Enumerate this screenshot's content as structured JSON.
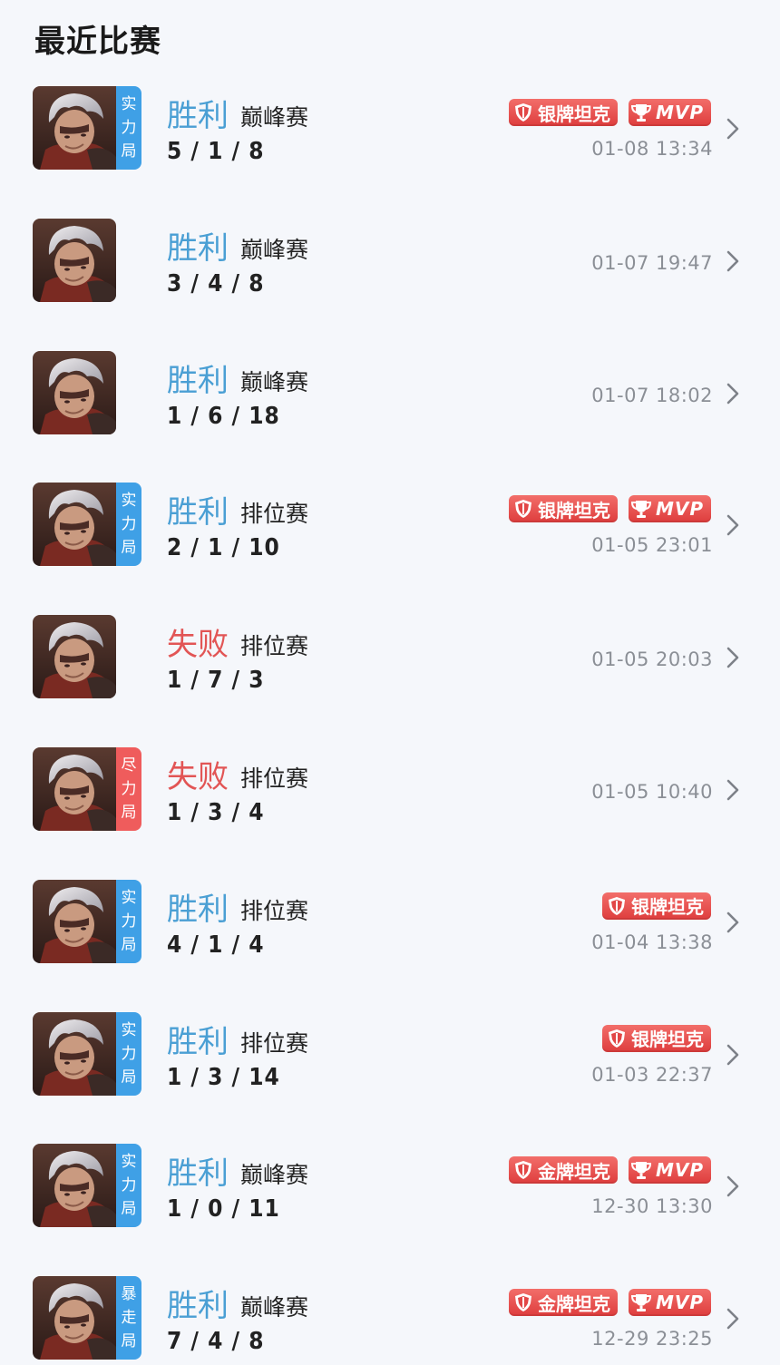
{
  "page": {
    "title": "最近比赛"
  },
  "colors": {
    "win": "#4a9fd4",
    "loss": "#e25555",
    "tag_blue": "#3fa0e6",
    "tag_red": "#ef5c5c",
    "badge_red": "#e24646"
  },
  "icons": {
    "tank_badge": "shield-icon",
    "mvp_badge": "trophy-icon",
    "chevron": "chevron-right-icon"
  },
  "matches": [
    {
      "result": "胜利",
      "outcome": "win",
      "mode": "巅峰赛",
      "kda": "5 / 1 / 8",
      "time": "01-08  13:34",
      "tag": [
        "实",
        "力",
        "局"
      ],
      "tag_color": "blue",
      "badges": [
        "银牌坦克",
        "MVP"
      ]
    },
    {
      "result": "胜利",
      "outcome": "win",
      "mode": "巅峰赛",
      "kda": "3 / 4 / 8",
      "time": "01-07  19:47",
      "tag": null,
      "badges": []
    },
    {
      "result": "胜利",
      "outcome": "win",
      "mode": "巅峰赛",
      "kda": "1 / 6 / 18",
      "time": "01-07  18:02",
      "tag": null,
      "badges": []
    },
    {
      "result": "胜利",
      "outcome": "win",
      "mode": "排位赛",
      "kda": "2 / 1 / 10",
      "time": "01-05  23:01",
      "tag": [
        "实",
        "力",
        "局"
      ],
      "tag_color": "blue",
      "badges": [
        "银牌坦克",
        "MVP"
      ]
    },
    {
      "result": "失败",
      "outcome": "loss",
      "mode": "排位赛",
      "kda": "1 / 7 / 3",
      "time": "01-05  20:03",
      "tag": null,
      "badges": []
    },
    {
      "result": "失败",
      "outcome": "loss",
      "mode": "排位赛",
      "kda": "1 / 3 / 4",
      "time": "01-05  10:40",
      "tag": [
        "尽",
        "力",
        "局"
      ],
      "tag_color": "red",
      "badges": []
    },
    {
      "result": "胜利",
      "outcome": "win",
      "mode": "排位赛",
      "kda": "4 / 1 / 4",
      "time": "01-04  13:38",
      "tag": [
        "实",
        "力",
        "局"
      ],
      "tag_color": "blue",
      "badges": [
        "银牌坦克"
      ]
    },
    {
      "result": "胜利",
      "outcome": "win",
      "mode": "排位赛",
      "kda": "1 / 3 / 14",
      "time": "01-03  22:37",
      "tag": [
        "实",
        "力",
        "局"
      ],
      "tag_color": "blue",
      "badges": [
        "银牌坦克"
      ]
    },
    {
      "result": "胜利",
      "outcome": "win",
      "mode": "巅峰赛",
      "kda": "1 / 0 / 11",
      "time": "12-30  13:30",
      "tag": [
        "实",
        "力",
        "局"
      ],
      "tag_color": "blue",
      "badges": [
        "金牌坦克",
        "MVP"
      ]
    },
    {
      "result": "胜利",
      "outcome": "win",
      "mode": "巅峰赛",
      "kda": "7 / 4 / 8",
      "time": "12-29  23:25",
      "tag": [
        "暴",
        "走",
        "局"
      ],
      "tag_color": "blue",
      "badges": [
        "金牌坦克",
        "MVP"
      ]
    }
  ]
}
